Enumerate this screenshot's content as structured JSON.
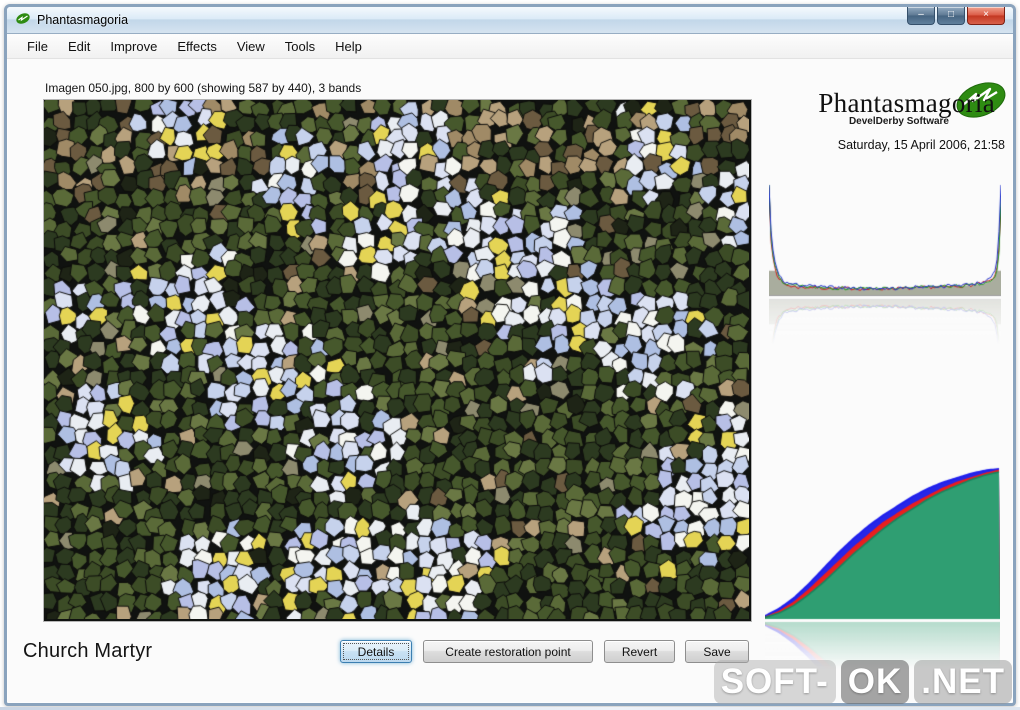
{
  "window": {
    "title": "Phantasmagoria"
  },
  "icons": {
    "minimize": "–",
    "maximize": "□",
    "close": "×"
  },
  "menu": {
    "items": [
      "File",
      "Edit",
      "Improve",
      "Effects",
      "View",
      "Tools",
      "Help"
    ]
  },
  "main": {
    "image_caption": "Imagen 050.jpg, 800 by 600 (showing 587 by 440), 3 bands",
    "image_title": "Church Martyr",
    "buttons": [
      {
        "label": "Details"
      },
      {
        "label": "Create restoration point"
      },
      {
        "label": "Revert"
      },
      {
        "label": "Save"
      }
    ]
  },
  "sidebar": {
    "brand_name": "Phantasmagoria",
    "brand_subtitle": "DevelDerby Software",
    "datetime": "Saturday, 15 April 2006, 21:58"
  },
  "watermark": {
    "part1": "SOFT-",
    "part2": "OK",
    "part3": ".NET"
  },
  "mosaic": {
    "background": "#101210",
    "stroke": "#0d0d0b",
    "seed": 20060415,
    "flower_colors": [
      "#f4f5f0",
      "#e9edf2",
      "#c6d2ec",
      "#aebfe2",
      "#b7bfe6",
      "#e4d455",
      "#dbe1f2"
    ],
    "ground_colors": [
      "#2c3a20",
      "#3c4c26",
      "#46582c",
      "#5a6a38",
      "#6a7844",
      "#8d8a6e",
      "#b7a17d",
      "#a08a66",
      "#6b5a40",
      "#1e2416"
    ]
  },
  "chart_data": [
    {
      "type": "line",
      "title": "RGB histogram",
      "xlabel": "",
      "ylabel": "",
      "xlim": [
        0,
        255
      ],
      "ylim": [
        0,
        100
      ],
      "legend_position": "none",
      "x": [
        0,
        2,
        5,
        8,
        12,
        16,
        24,
        32,
        48,
        64,
        80,
        96,
        112,
        128,
        144,
        160,
        176,
        192,
        208,
        224,
        236,
        244,
        250,
        253,
        255
      ],
      "series": [
        {
          "name": "red",
          "color": "#cc2222",
          "values": [
            98,
            50,
            30,
            20,
            14,
            10,
            8,
            7,
            7,
            6,
            6,
            6,
            5,
            6,
            6,
            6,
            7,
            7,
            8,
            9,
            11,
            13,
            20,
            45,
            80
          ]
        },
        {
          "name": "green",
          "color": "#22991f",
          "values": [
            100,
            55,
            32,
            22,
            15,
            11,
            9,
            8,
            7,
            7,
            6,
            6,
            6,
            6,
            6,
            7,
            7,
            8,
            8,
            9,
            10,
            12,
            18,
            40,
            88
          ]
        },
        {
          "name": "blue",
          "color": "#2233cc",
          "values": [
            100,
            60,
            36,
            25,
            17,
            12,
            10,
            9,
            8,
            7,
            7,
            6,
            6,
            6,
            6,
            7,
            8,
            8,
            9,
            10,
            12,
            15,
            25,
            60,
            100
          ]
        }
      ],
      "fill_under_color": "rgba(115,122,96,0.6)"
    },
    {
      "type": "area",
      "title": "Cumulative RGB histogram",
      "xlabel": "",
      "ylabel": "",
      "xlim": [
        0,
        255
      ],
      "ylim": [
        0,
        100
      ],
      "legend_position": "none",
      "x": [
        0,
        16,
        32,
        48,
        64,
        80,
        96,
        112,
        128,
        144,
        160,
        176,
        192,
        208,
        224,
        240,
        255
      ],
      "series": [
        {
          "name": "blue",
          "color": "#2626e8",
          "stroke": "#1c1cee",
          "values": [
            2,
            7,
            14,
            23,
            33,
            43,
            52,
            60,
            67,
            73,
            79,
            84,
            88,
            91,
            94,
            96,
            97
          ]
        },
        {
          "name": "red",
          "color": "#e82020",
          "stroke": "#ee1c1c",
          "values": [
            1,
            5,
            11,
            19,
            28,
            37,
            46,
            54,
            62,
            68,
            74,
            79,
            84,
            88,
            91,
            94,
            96
          ]
        },
        {
          "name": "green",
          "color": "#2f9e72",
          "stroke": "#16865f",
          "values": [
            1,
            4,
            9,
            16,
            24,
            33,
            42,
            50,
            58,
            65,
            71,
            77,
            82,
            86,
            90,
            93,
            95
          ]
        }
      ]
    }
  ]
}
